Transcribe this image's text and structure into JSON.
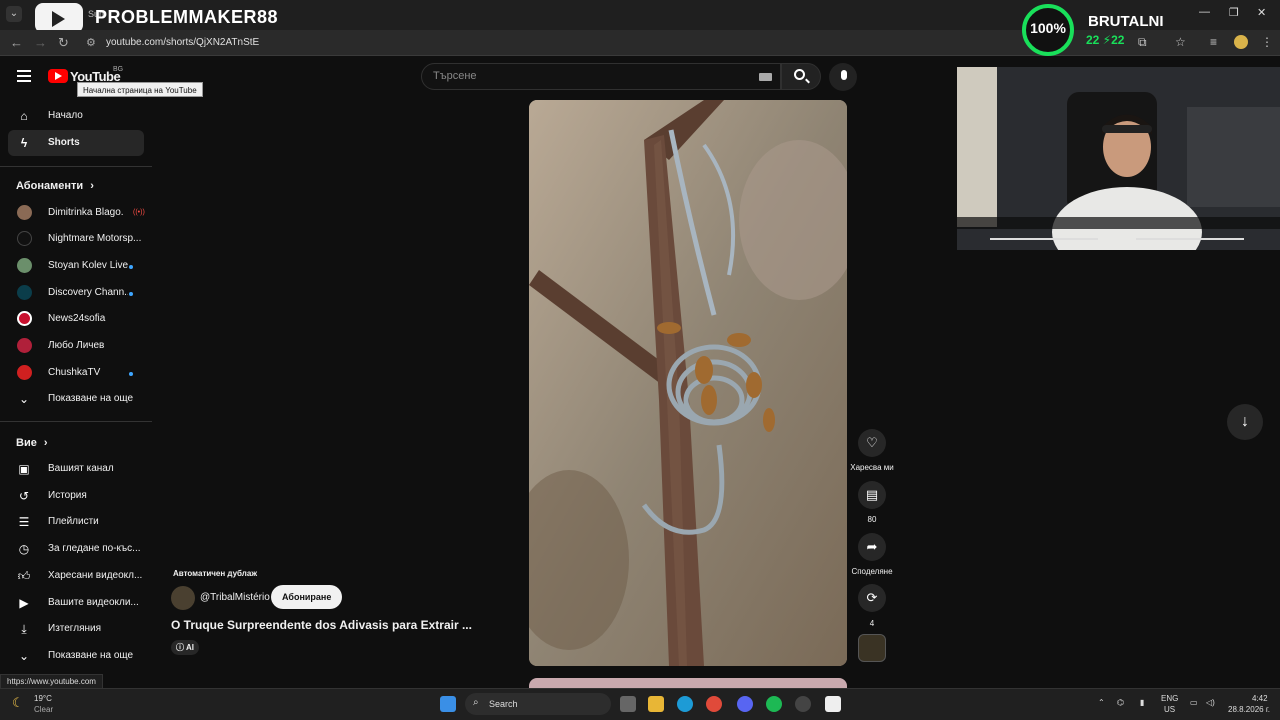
{
  "browser": {
    "url": "youtube.com/shorts/QjXN2ATnStE",
    "tab_fragment": "Sun"
  },
  "overlay": {
    "streamer_name": "PROBLEMMAKER88",
    "ring_value": "100%",
    "brand": "BRUTALNI",
    "brand_sub": "22 ⚡22"
  },
  "header": {
    "logo_text": "YouTube",
    "region": "BG",
    "tooltip": "Начална страница на YouTube",
    "search_placeholder": "Търсене"
  },
  "sidebar": {
    "main": [
      {
        "label": "Начало",
        "icon": "home-icon"
      },
      {
        "label": "Shorts",
        "icon": "shorts-icon"
      }
    ],
    "subs_title": "Абонаменти",
    "subscriptions": [
      {
        "name": "Dimitrinka Blago...",
        "color": "#8a6a55",
        "badge": "live"
      },
      {
        "name": "Nightmare Motorsp...",
        "color": "#111111",
        "badge": ""
      },
      {
        "name": "Stoyan Kolev Live",
        "color": "#6b8f6b",
        "badge": "dot"
      },
      {
        "name": "Discovery Chann...",
        "color": "#0b3d4a",
        "badge": "dot"
      },
      {
        "name": "News24sofia",
        "color": "#c8102e",
        "badge": ""
      },
      {
        "name": "Любо Личев",
        "color": "#b0203a",
        "badge": ""
      },
      {
        "name": "ChushkaTV",
        "color": "#d02020",
        "badge": "dot"
      }
    ],
    "show_more_1": "Показване на още",
    "you_title": "Вие",
    "you_items": [
      {
        "label": "Вашият канал",
        "icon": "channel-icon"
      },
      {
        "label": "История",
        "icon": "history-icon"
      },
      {
        "label": "Плейлисти",
        "icon": "playlists-icon"
      },
      {
        "label": "За гледане по-къс...",
        "icon": "watch-later-icon"
      },
      {
        "label": "Харесани видеокл...",
        "icon": "liked-icon"
      },
      {
        "label": "Вашите видеокли...",
        "icon": "your-videos-icon"
      },
      {
        "label": "Изтегляния",
        "icon": "downloads-icon"
      }
    ],
    "show_more_2": "Показване на още"
  },
  "short": {
    "auto_dub": "Автоматичен дублаж",
    "handle": "@TribalMistério",
    "subscribe": "Абониране",
    "title": "O Truque Surpreendente dos Adivasis para Extrair ...",
    "ai_badge": "AI",
    "actions": {
      "like": "Харесва ми",
      "comments": "80",
      "share": "Споделяне",
      "remix": "4"
    }
  },
  "status_bar_url": "https://www.youtube.com",
  "taskbar": {
    "weather_temp": "19°C",
    "weather_desc": "Clear",
    "search": "Search",
    "lang": "ENG",
    "region": "US",
    "time": "4:42",
    "date": "28.8.2026 г."
  },
  "colors": {
    "accent_red": "#ff0000",
    "ring_green": "#19e05a",
    "live_blue": "#3ea6ff"
  }
}
